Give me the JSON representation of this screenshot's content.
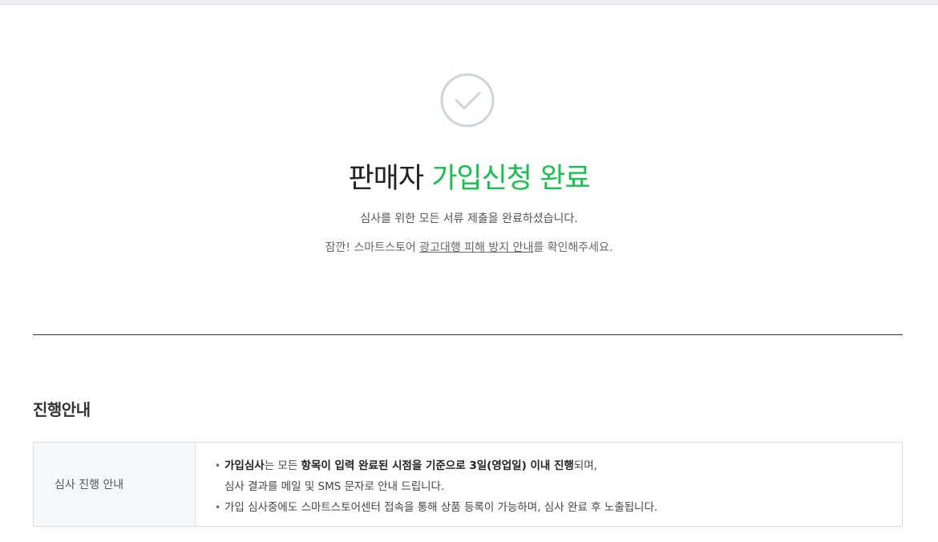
{
  "header": {
    "title_part1": "판매자",
    "title_part2": "가입신청 완료",
    "description": "심사를 위한 모든 서류 제출을 완료하셨습니다.",
    "notice_prefix": "잠깐! 스마트스토어 ",
    "notice_link": "광고대행 피해 방지 안내",
    "notice_suffix": "를 확인해주세요."
  },
  "section": {
    "title": "진행안내",
    "row_label": "심사 진행 안내",
    "bullet1_bold1": "가입심사",
    "bullet1_text1": "는 모든 ",
    "bullet1_bold2": "항목이 입력 완료된 시점을 기준으로 3일(영업일) 이내 진행",
    "bullet1_text2": "되며,",
    "bullet1_line2": "심사 결과를 메일 및 SMS 문자로 안내 드립니다.",
    "bullet2": "가입 심사중에도 스마트스토어센터 접속을 통해 상품 등록이 가능하며, 심사 완료 후 노출됩니다."
  },
  "colors": {
    "accent_green": "#13c34a",
    "check_icon": "#cfd4db"
  },
  "icons": {
    "status": "check-circle-icon",
    "bullet": "dot-bullet"
  }
}
